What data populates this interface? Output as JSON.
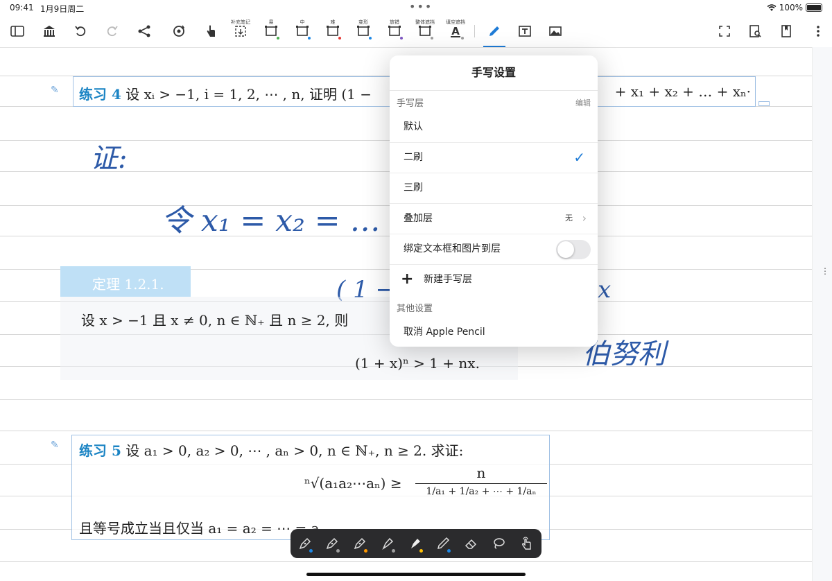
{
  "status": {
    "time": "09:41",
    "date": "1月9日周二",
    "battery": "100%"
  },
  "toolbar": {
    "labels": {
      "supplement": "补充笔记",
      "easy": "易",
      "medium": "中",
      "hard": "难",
      "variant": "变形",
      "mistake": "放错",
      "whole_mask": "整体遮挡",
      "fill_mask": "填空遮挡"
    },
    "colors": {
      "easy": "#4caf50",
      "medium": "#1e88e5",
      "hard": "#e53935",
      "variant": "#1e88e5",
      "mistake": "#7e57c2",
      "whole": "#9e9e9e",
      "fill": "#9e9e9e",
      "accent": "#1e7bd6"
    }
  },
  "doc": {
    "ex4_label": "练习 4",
    "ex4_text": "设 xᵢ > −1, i = 1, 2, ⋯ , n, 证明 (1 −",
    "ex4_right": "+ x₁ + x₂ + … + xₙ·",
    "hand_zheng": "证:",
    "hand_ling": "令 x₁ = x₂ = … ·",
    "hand_paren": "( 1 −",
    "hand_x": "x",
    "hand_bernoulli": "伯努利",
    "theorem_label": "定理 1.2.1.",
    "theorem_text": "设 x > −1 且 x ≠ 0, n ∈ ℕ₊ 且 n ≥ 2, 则",
    "theorem_formula": "(1 + x)ⁿ > 1 + nx.",
    "ex5_label": "练习 5",
    "ex5_text": "设 a₁ > 0, a₂ > 0, ⋯ , aₙ > 0, n ∈ ℕ₊, n ≥ 2. 求证:",
    "ex5_root": "ⁿ√(a₁a₂⋯aₙ) ≥",
    "ex5_num": "n",
    "ex5_den": "1/a₁ + 1/a₂ + ⋯ + 1/aₙ",
    "ex5_tail": "且等号成立当且仅当 a₁ = a₂ = ⋯ = aₙ"
  },
  "popover": {
    "title": "手写设置",
    "section_layers": "手写层",
    "edit": "编辑",
    "layer_default": "默认",
    "layer_second": "二刷",
    "layer_third": "三刷",
    "overlay": "叠加层",
    "overlay_value": "无",
    "bind_label": "绑定文本框和图片到层",
    "bind_on": false,
    "new_layer": "新建手写层",
    "section_other": "其他设置",
    "cancel_pencil": "取消 Apple Pencil"
  },
  "pentray": {
    "colors": {
      "pen1": "#1e88e5",
      "pen2": "#9e9e9e",
      "pen3": "#ff9800",
      "highlighter1": "#9e9e9e",
      "highlighter2": "#ffc107",
      "pencil": "#1e88e5"
    }
  }
}
